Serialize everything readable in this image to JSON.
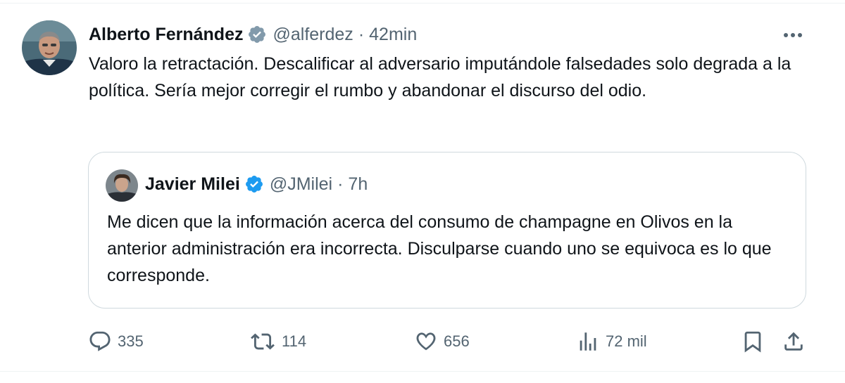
{
  "tweet": {
    "author": {
      "name": "Alberto Fernández",
      "handle": "@alferdez",
      "separator": "·",
      "time": "42min"
    },
    "text": "Valoro la retractación. Descalificar al adversario imputándole falsedades solo degrada a la política. Sería mejor corregir el rumbo y abandonar el discurso del odio.",
    "quoted": {
      "name": "Javier Milei",
      "handle": "@JMilei",
      "separator": "·",
      "time": "7h",
      "text": "Me dicen que la información acerca del consumo de champagne en Olivos en la anterior administración era incorrecta. Disculparse cuando uno se equivoca es lo que corresponde."
    },
    "actions": {
      "replies": "335",
      "retweets": "114",
      "likes": "656",
      "views": "72 mil"
    }
  },
  "icons": {
    "verified": "verified-badge-icon",
    "more": "more-horizontal-icon",
    "reply": "reply-icon",
    "retweet": "retweet-icon",
    "like": "heart-icon",
    "views": "views-chart-icon",
    "bookmark": "bookmark-icon",
    "share": "share-icon"
  },
  "colors": {
    "verified": "#1d9bf0",
    "text": "#0f1419",
    "secondary": "#536471",
    "border": "#cfd9de"
  }
}
